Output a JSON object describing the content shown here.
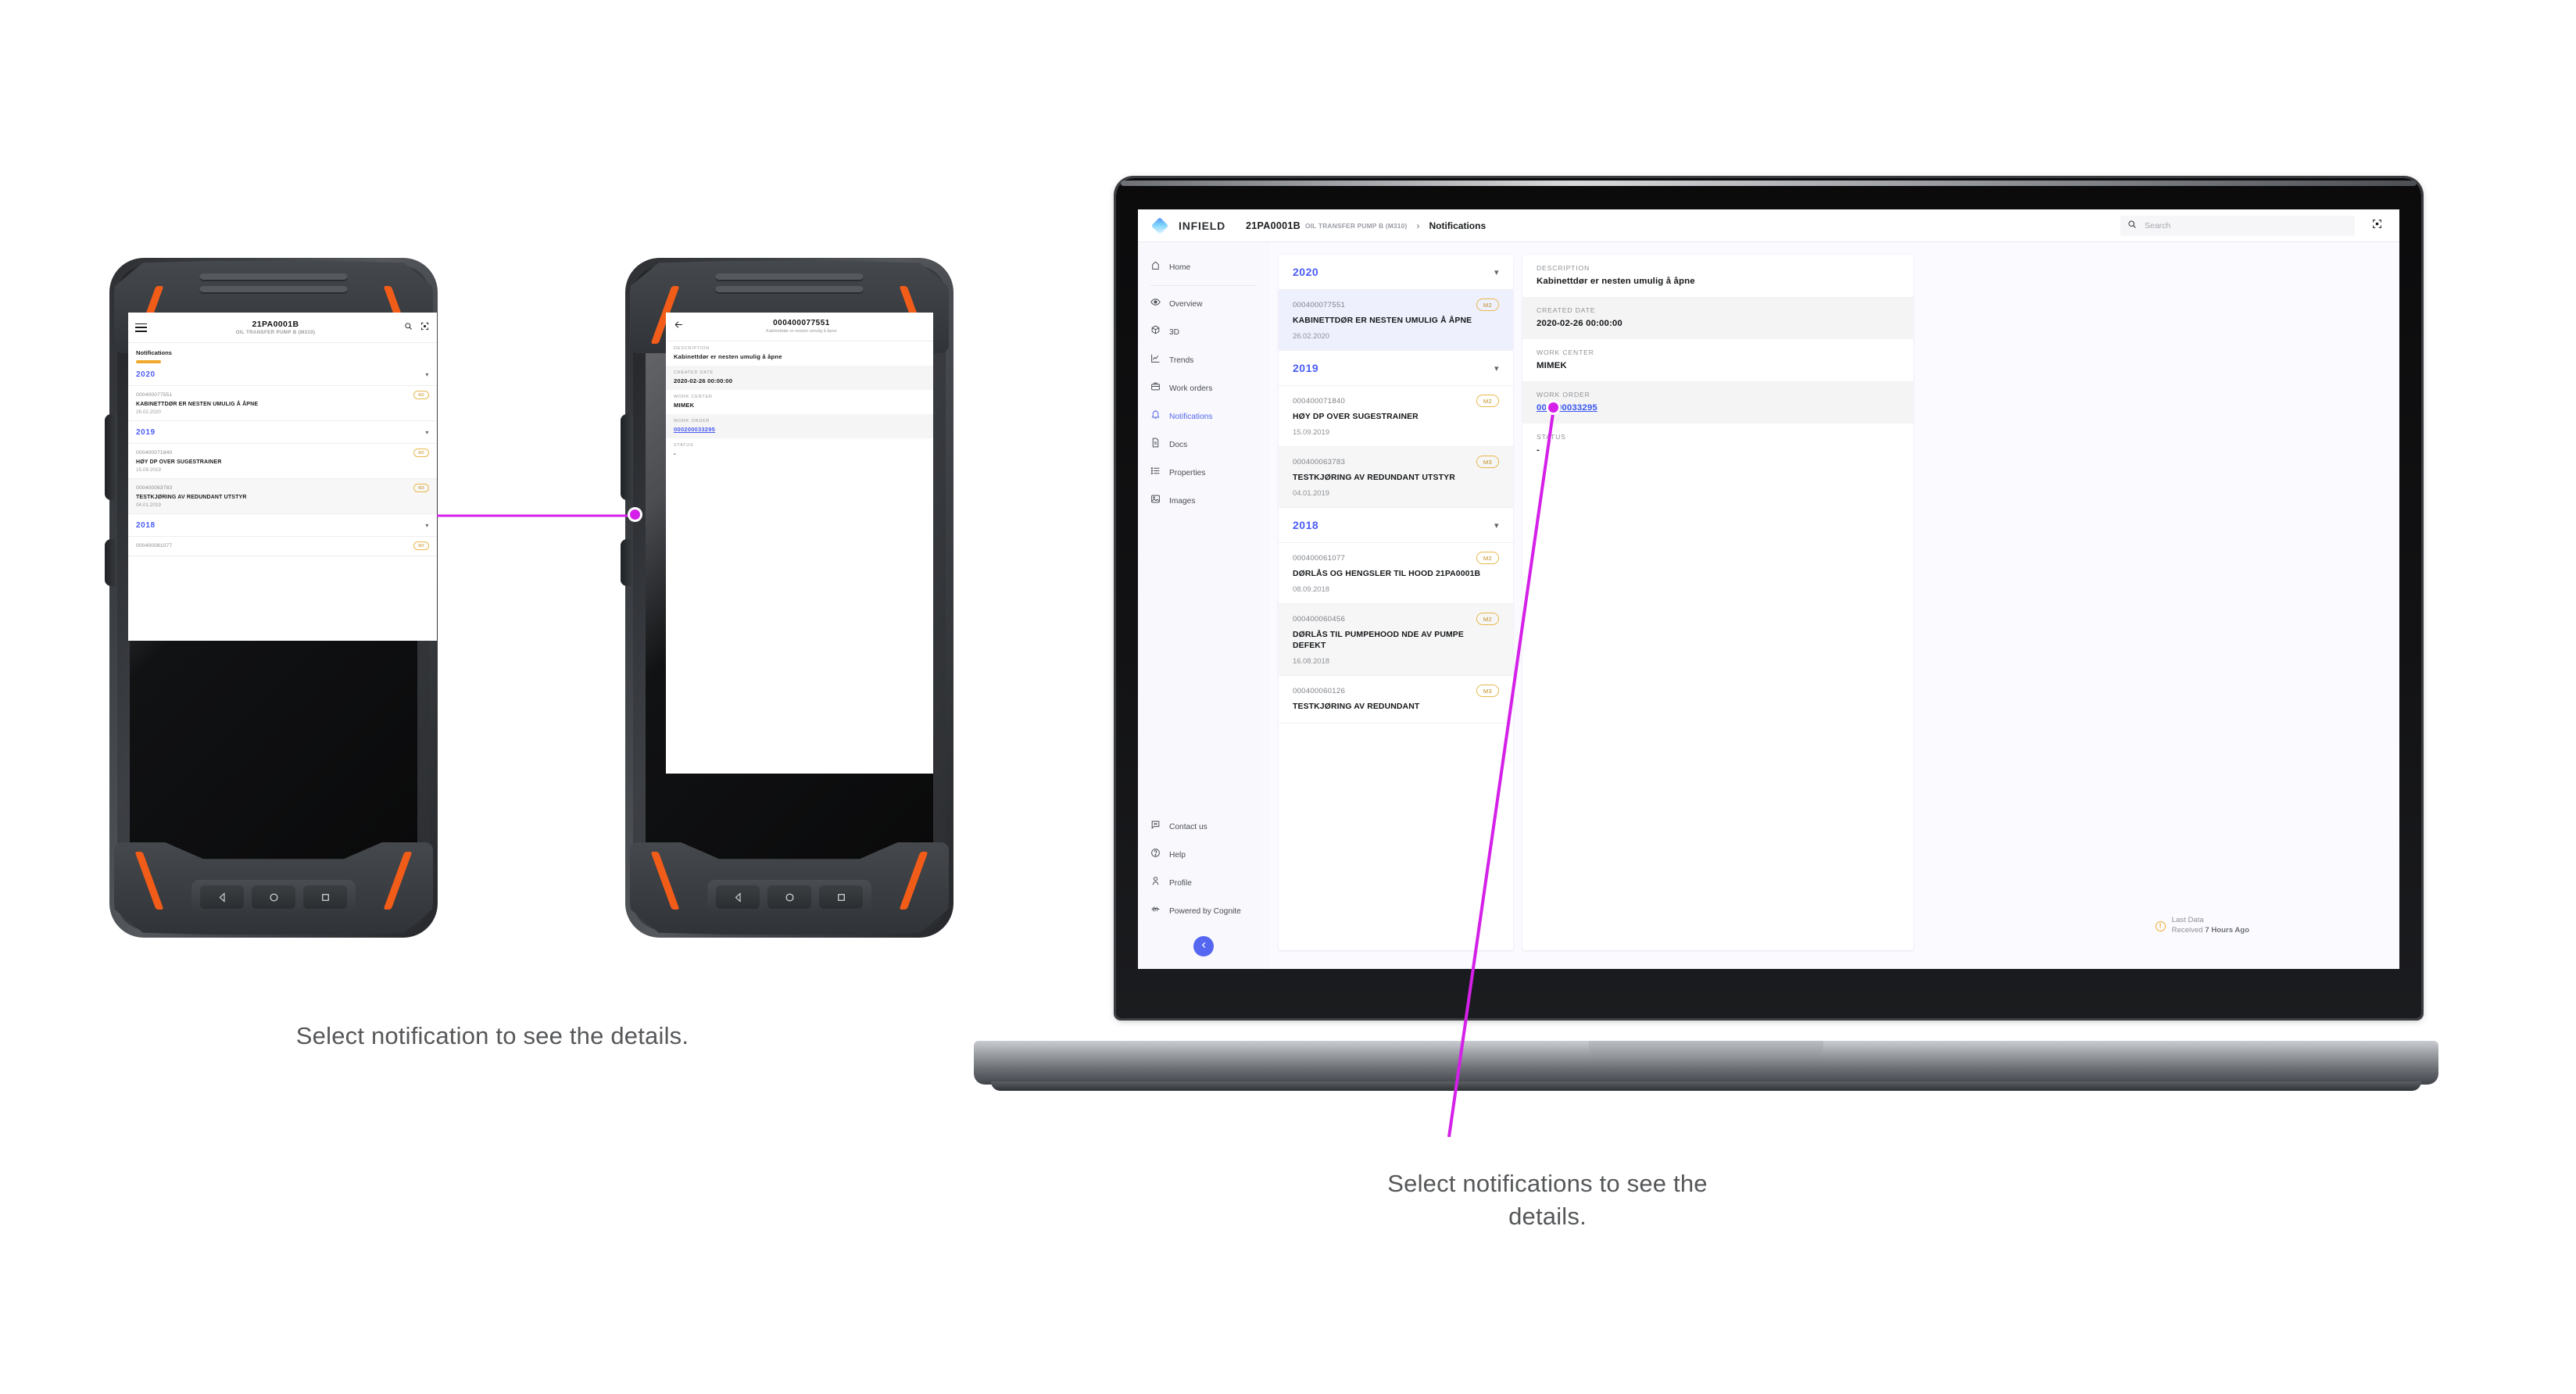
{
  "page": {
    "caption_phone": "Select notification to see the details.",
    "caption_laptop": "Select notifications to see the\ndetails.",
    "accent_purple": "#d420e8",
    "accent_blue": "#4a5cf5",
    "accent_amber": "#e8b84b"
  },
  "phone_list": {
    "header": {
      "title": "21PA0001B",
      "subtitle": "OIL TRANSFER PUMP B  (M310)",
      "menu_icon": "hamburger-icon",
      "search_icon": "search-icon",
      "fullscreen_icon": "fullscreen-icon"
    },
    "tab": {
      "label": "Notifications"
    },
    "groups": [
      {
        "year": "2020",
        "items": [
          {
            "id": "000400077551",
            "badge": "M2",
            "desc": "KABINETTDØR ER NESTEN UMULIG Å ÅPNE",
            "date": "26.02.2020"
          }
        ]
      },
      {
        "year": "2019",
        "items": [
          {
            "id": "000400071840",
            "badge": "M2",
            "desc": "HØY DP OVER SUGESTRAINER",
            "date": "15.09.2019"
          },
          {
            "id": "000400063783",
            "badge": "M3",
            "desc": "TESTKJØRING AV REDUNDANT UTSTYR",
            "date": "04.01.2019"
          }
        ]
      },
      {
        "year": "2018",
        "items": [
          {
            "id": "000400061077",
            "badge": "M2",
            "desc": "",
            "date": ""
          }
        ]
      }
    ]
  },
  "phone_detail": {
    "header": {
      "back_icon": "back-arrow-icon",
      "title": "000400077551",
      "subtitle": "Kabinettdør er nesten umulig å åpne"
    },
    "fields": [
      {
        "label": "DESCRIPTION",
        "value": "Kabinettdør er nesten umulig å åpne",
        "link": false
      },
      {
        "label": "CREATED DATE",
        "value": "2020-02-26 00:00:00",
        "link": false
      },
      {
        "label": "WORK CENTER",
        "value": "MIMEK",
        "link": false
      },
      {
        "label": "WORK ORDER",
        "value": "000200033295",
        "link": true
      },
      {
        "label": "STATUS",
        "value": "-",
        "link": false
      }
    ]
  },
  "laptop": {
    "topbar": {
      "logo_icon": "infield-diamond-logo",
      "brand": "INFIELD",
      "breadcrumb_asset": "21PA0001B",
      "breadcrumb_asset_sub": "OIL TRANSFER PUMP B (M310)",
      "breadcrumb_separator": "›",
      "breadcrumb_page": "Notifications",
      "search_icon": "search-icon",
      "search_placeholder": "Search",
      "search_value": "",
      "fullscreen_icon": "fullscreen-icon"
    },
    "sidebar": {
      "items": [
        {
          "label": "Home",
          "icon": "home-icon",
          "active": false
        },
        {
          "label": "Overview",
          "icon": "eye-icon",
          "active": false
        },
        {
          "label": "3D",
          "icon": "cube-icon",
          "active": false
        },
        {
          "label": "Trends",
          "icon": "chart-line-icon",
          "active": false
        },
        {
          "label": "Work orders",
          "icon": "briefcase-icon",
          "active": false
        },
        {
          "label": "Notifications",
          "icon": "bell-icon",
          "active": true
        },
        {
          "label": "Docs",
          "icon": "document-icon",
          "active": false
        },
        {
          "label": "Properties",
          "icon": "list-icon",
          "active": false
        },
        {
          "label": "Images",
          "icon": "image-icon",
          "active": false
        }
      ],
      "bottom_items": [
        {
          "label": "Contact us",
          "icon": "chat-icon"
        },
        {
          "label": "Help",
          "icon": "question-circle-icon"
        },
        {
          "label": "Profile",
          "icon": "person-icon"
        },
        {
          "label": "Powered by Cognite",
          "icon": "cognite-logo-icon"
        }
      ],
      "collapse_icon": "chevron-left-icon"
    },
    "notifications": {
      "groups": [
        {
          "year": "2020",
          "items": [
            {
              "id": "000400077551",
              "badge": "M2",
              "desc": "KABINETTDØR ER NESTEN UMULIG Å ÅPNE",
              "date": "26.02.2020",
              "selected": true
            }
          ]
        },
        {
          "year": "2019",
          "items": [
            {
              "id": "000400071840",
              "badge": "M2",
              "desc": "HØY DP OVER SUGESTRAINER",
              "date": "15.09.2019",
              "selected": false
            },
            {
              "id": "000400063783",
              "badge": "M3",
              "desc": "TESTKJØRING AV REDUNDANT UTSTYR",
              "date": "04.01.2019",
              "selected": false
            }
          ]
        },
        {
          "year": "2018",
          "items": [
            {
              "id": "000400061077",
              "badge": "M2",
              "desc": "DØRLÅS OG HENGSLER TIL HOOD 21PA0001B",
              "date": "08.09.2018",
              "selected": false
            },
            {
              "id": "000400060456",
              "badge": "M2",
              "desc": "DØRLÅS TIL PUMPEHOOD NDE AV PUMPE DEFEKT",
              "date": "16.08.2018",
              "selected": false
            },
            {
              "id": "000400060126",
              "badge": "M3",
              "desc": "TESTKJØRING AV REDUNDANT",
              "date": "",
              "selected": false
            }
          ]
        }
      ]
    },
    "detail": {
      "fields": [
        {
          "label": "DESCRIPTION",
          "value": "Kabinettdør er nesten umulig å åpne",
          "link": false
        },
        {
          "label": "CREATED DATE",
          "value": "2020-02-26 00:00:00",
          "link": false
        },
        {
          "label": "WORK CENTER",
          "value": "MIMEK",
          "link": false
        },
        {
          "label": "WORK ORDER",
          "value": "000200033295",
          "link": true
        },
        {
          "label": "STATUS",
          "value": "-",
          "link": false
        }
      ]
    },
    "last_data": {
      "icon": "warning-circle-icon",
      "line1": "Last Data",
      "line2_prefix": "Received ",
      "line2_strong": "7 Hours Ago"
    }
  }
}
